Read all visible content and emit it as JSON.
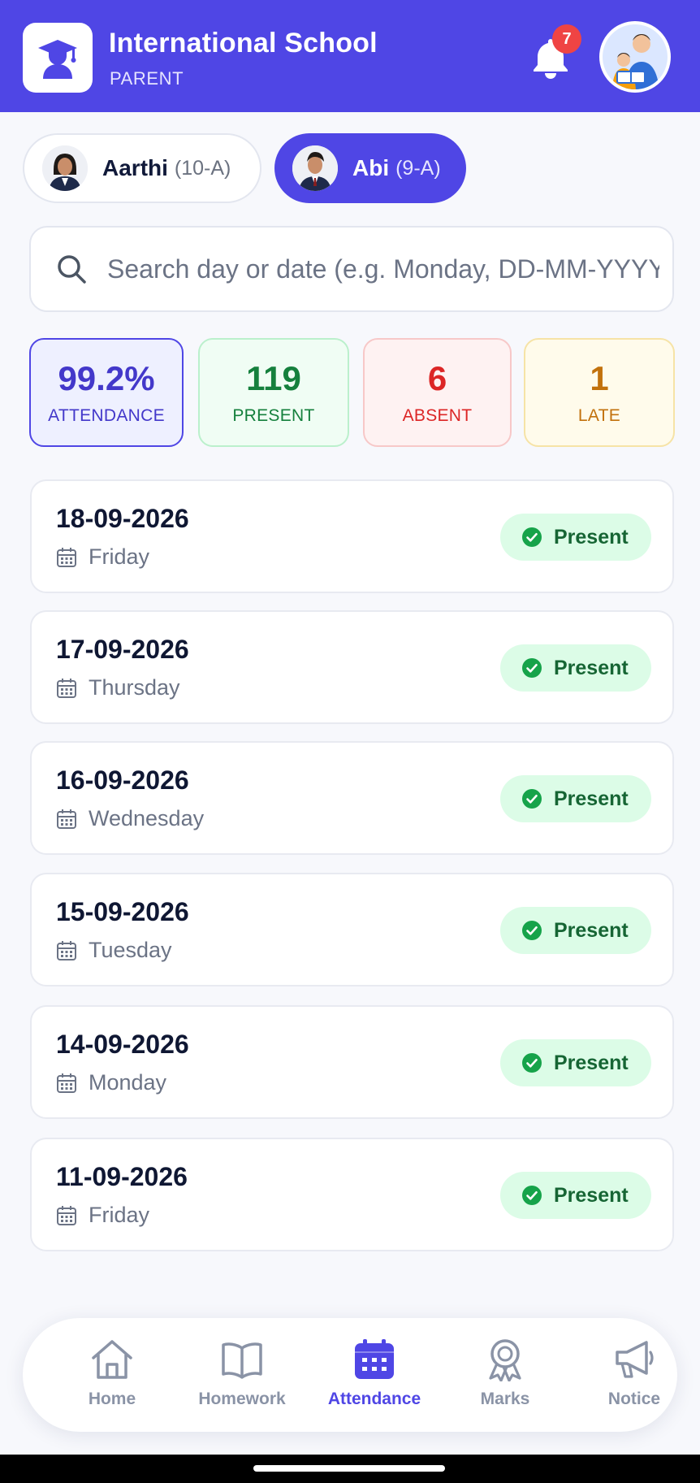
{
  "header": {
    "school_name": "International School",
    "role": "PARENT",
    "notification_count": "7"
  },
  "children": [
    {
      "name": "Aarthi",
      "class": "(10-A)",
      "selected": false
    },
    {
      "name": "Abi",
      "class": "(9-A)",
      "selected": true
    }
  ],
  "search": {
    "placeholder": "Search day or date (e.g. Monday, DD-MM-YYYY)",
    "value": ""
  },
  "stats": {
    "attendance": {
      "value": "99.2%",
      "label": "ATTENDANCE"
    },
    "present": {
      "value": "119",
      "label": "PRESENT"
    },
    "absent": {
      "value": "6",
      "label": "ABSENT"
    },
    "late": {
      "value": "1",
      "label": "LATE"
    }
  },
  "records": [
    {
      "date": "18-09-2026",
      "day": "Friday",
      "status": "Present"
    },
    {
      "date": "17-09-2026",
      "day": "Thursday",
      "status": "Present"
    },
    {
      "date": "16-09-2026",
      "day": "Wednesday",
      "status": "Present"
    },
    {
      "date": "15-09-2026",
      "day": "Tuesday",
      "status": "Present"
    },
    {
      "date": "14-09-2026",
      "day": "Monday",
      "status": "Present"
    },
    {
      "date": "11-09-2026",
      "day": "Friday",
      "status": "Present"
    }
  ],
  "nav": {
    "home": "Home",
    "homework": "Homework",
    "attendance": "Attendance",
    "marks": "Marks",
    "notice": "Notice",
    "active": "attendance"
  },
  "colors": {
    "primary": "#4f46e5",
    "present": "#15803d",
    "absent": "#dc2626",
    "late": "#c2710c"
  }
}
